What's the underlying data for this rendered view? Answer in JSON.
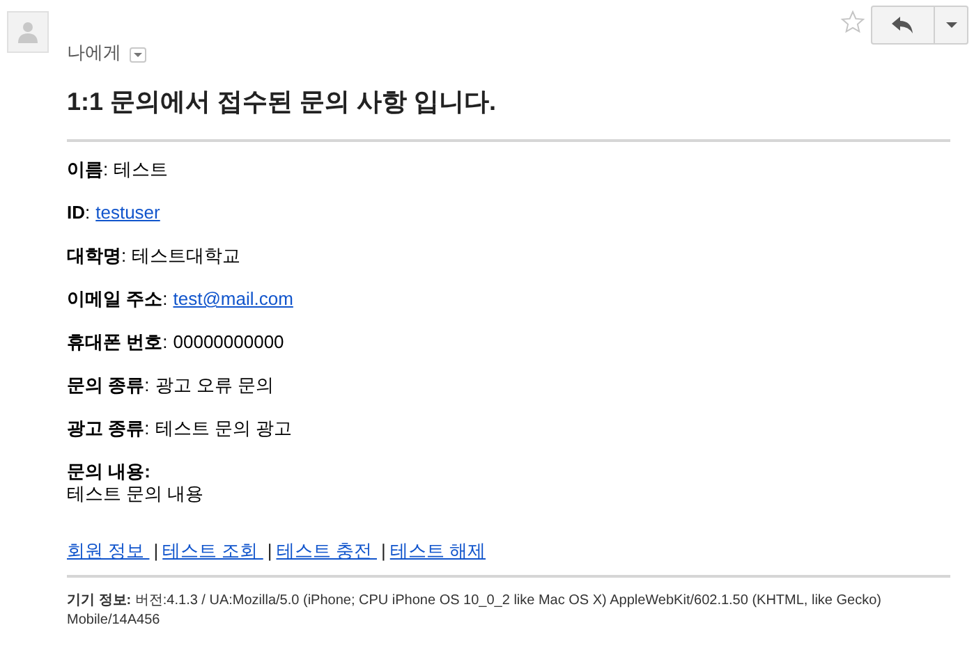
{
  "header": {
    "recipient": "나에게"
  },
  "title": "1:1 문의에서 접수된 문의 사항 입니다.",
  "fields": [
    {
      "label": "**이름**:",
      "value": "테스트",
      "kind": "text"
    },
    {
      "label": "**ID**:",
      "value": "testuser",
      "kind": "link"
    },
    {
      "label": "**대학명**:",
      "value": "테스트대학교",
      "kind": "text"
    },
    {
      "label": "**이메일 주소**:",
      "value": "test@mail.com",
      "kind": "link"
    },
    {
      "label": "**휴대폰 번호**:",
      "value": "00000000000",
      "kind": "text"
    },
    {
      "label": "**문의 종류**:",
      "value": "광고 오류 문의",
      "kind": "text"
    },
    {
      "label": "**광고 종류**:",
      "value": "테스트 문의 광고",
      "kind": "text"
    },
    {
      "label": "**문의 내용:**",
      "value": "테스트 문의 내용",
      "kind": "block"
    }
  ],
  "links": [
    "회원 정보 ",
    "테스트 조회 ",
    "테스트 충전 ",
    "테스트 해제"
  ],
  "separator": "|",
  "device_info": "**기기 정보:** 버전:4.1.3 / UA:Mozilla/5.0 (iPhone; CPU iPhone OS 10_0_2 like Mac OS X) AppleWebKit/602.1.50 (KHTML, like Gecko) Mobile/14A456"
}
